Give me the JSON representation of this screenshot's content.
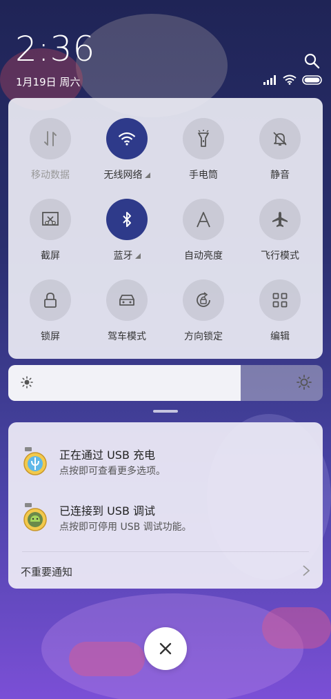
{
  "status": {
    "time": "2:36",
    "date": "1月19日 周六"
  },
  "quick_settings": {
    "tiles": [
      {
        "label": "移动数据",
        "icon": "mobile-data-icon",
        "active": false
      },
      {
        "label": "无线网络",
        "icon": "wifi-icon",
        "active": true
      },
      {
        "label": "手电筒",
        "icon": "flashlight-icon",
        "active": false
      },
      {
        "label": "静音",
        "icon": "mute-bell-icon",
        "active": false
      },
      {
        "label": "截屏",
        "icon": "screenshot-icon",
        "active": false
      },
      {
        "label": "蓝牙",
        "icon": "bluetooth-icon",
        "active": true
      },
      {
        "label": "自动亮度",
        "icon": "auto-brightness-icon",
        "active": false
      },
      {
        "label": "飞行模式",
        "icon": "airplane-icon",
        "active": false
      },
      {
        "label": "锁屏",
        "icon": "lock-icon",
        "active": false
      },
      {
        "label": "驾车模式",
        "icon": "car-icon",
        "active": false
      },
      {
        "label": "方向锁定",
        "icon": "rotation-lock-icon",
        "active": false
      },
      {
        "label": "编辑",
        "icon": "edit-grid-icon",
        "active": false
      }
    ],
    "active_color": "#2e3a8a"
  },
  "brightness": {
    "level": 0.74
  },
  "notifications": [
    {
      "title": "正在通过 USB 充电",
      "desc": "点按即可查看更多选项。",
      "icon": "usb-charge-icon"
    },
    {
      "title": "已连接到 USB 调试",
      "desc": "点按即可停用 USB 调试功能。",
      "icon": "android-debug-icon"
    }
  ],
  "unimportant_label": "不重要通知"
}
